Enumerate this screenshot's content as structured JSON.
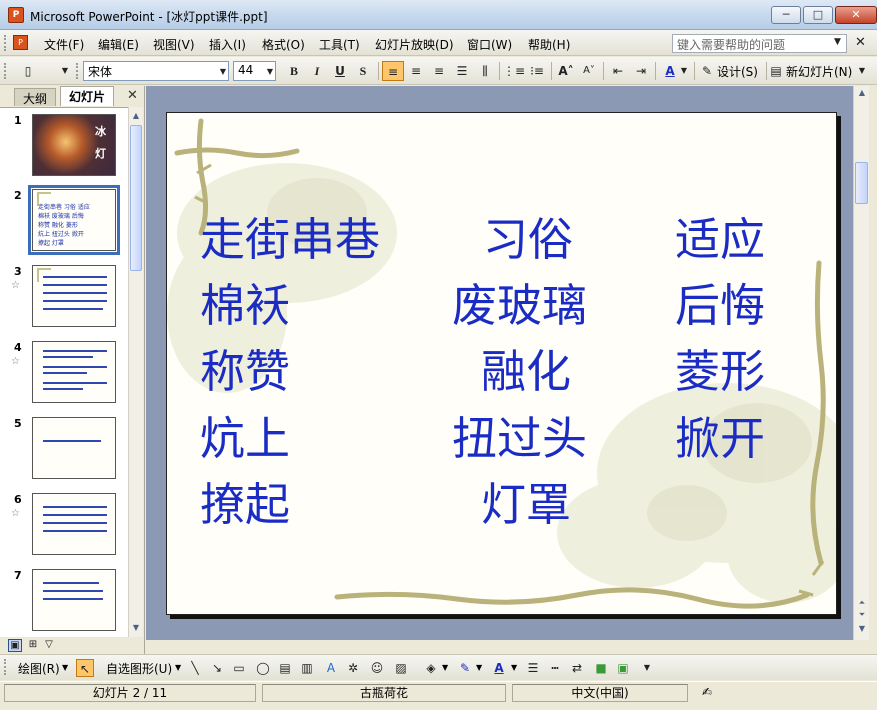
{
  "window": {
    "title": "Microsoft PowerPoint - [冰灯ppt课件.ppt]",
    "minimize": "─",
    "maximize": "□",
    "close": "✕"
  },
  "menu": {
    "items": [
      "文件(F)",
      "编辑(E)",
      "视图(V)",
      "插入(I)",
      "格式(O)",
      "工具(T)",
      "幻灯片放映(D)",
      "窗口(W)",
      "帮助(H)"
    ],
    "help_placeholder": "键入需要帮助的问题"
  },
  "toolbar": {
    "font": "宋体",
    "size": "44",
    "bold": "B",
    "italic": "I",
    "underline": "U",
    "shadow": "S",
    "design": "设计(S)",
    "new_slide": "新幻灯片(N)"
  },
  "pane": {
    "tab_outline": "大纲",
    "tab_slides": "幻灯片"
  },
  "slides_thumbs": [
    {
      "num": "1",
      "title_a": "冰",
      "title_b": "灯"
    },
    {
      "num": "2"
    },
    {
      "num": "3"
    },
    {
      "num": "4"
    },
    {
      "num": "5"
    },
    {
      "num": "6"
    },
    {
      "num": "7"
    }
  ],
  "slide": {
    "words": [
      [
        "走街串巷",
        "习俗",
        "适应"
      ],
      [
        "棉袄",
        "废玻璃",
        "后悔"
      ],
      [
        "称赞",
        "融化",
        "菱形"
      ],
      [
        "炕上",
        "扭过头",
        "掀开"
      ],
      [
        "撩起",
        "灯罩"
      ]
    ]
  },
  "drawing": {
    "draw_menu": "绘图(R)",
    "autoshapes": "自选图形(U)"
  },
  "status": {
    "slide_pos": "幻灯片 2 / 11",
    "design": "古瓶荷花",
    "lang": "中文(中国)"
  },
  "colors": {
    "slide_text": "#1a2cc4",
    "slide_bg": "#fffef9",
    "vine": "#b9b27a",
    "edit_bg": "#8c99b5"
  }
}
